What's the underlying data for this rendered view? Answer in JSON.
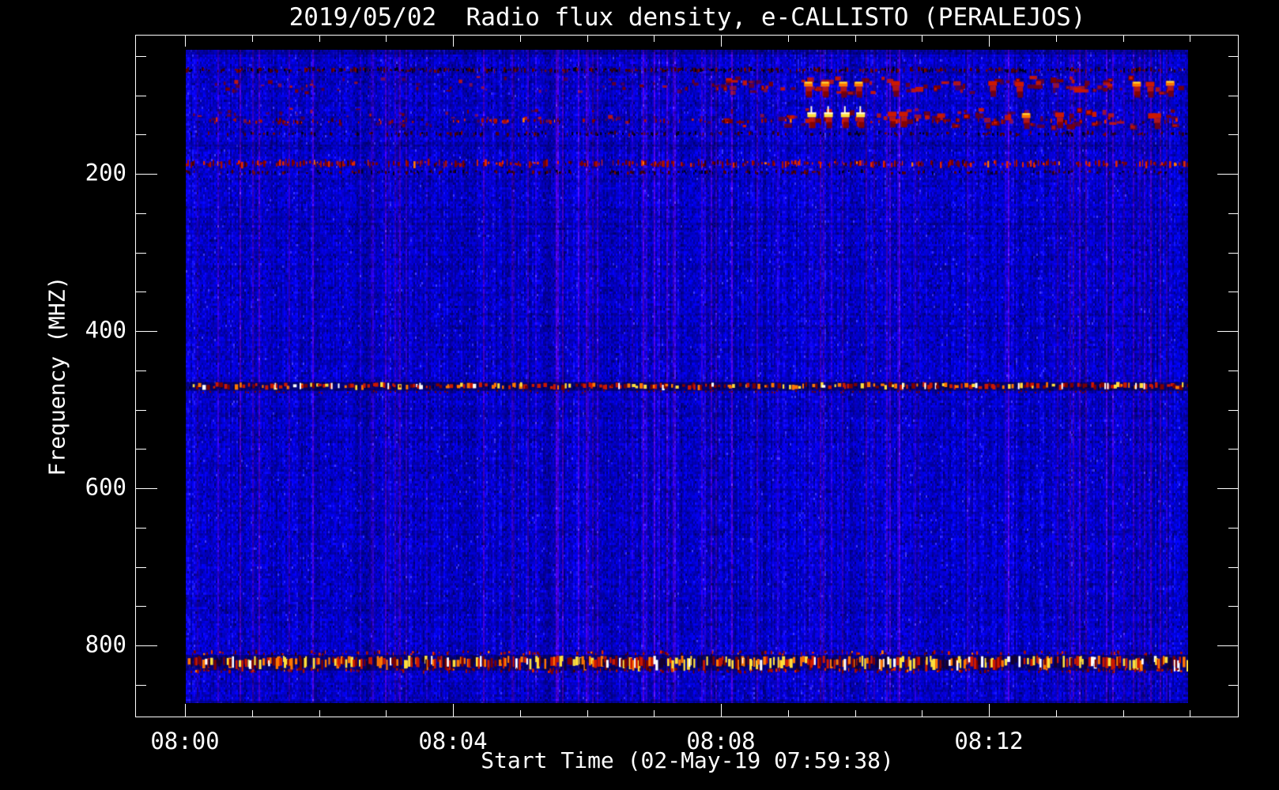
{
  "chart_data": {
    "type": "heatmap",
    "title": "2019/05/02  Radio flux density, e-CALLISTO (PERALEJOS)",
    "xlabel": "Start Time (02-May-19 07:59:38)",
    "ylabel": "Frequency (MHZ)",
    "instrument": "e-CALLISTO",
    "station": "PERALEJOS",
    "date": "2019/05/02",
    "start_time": "07:59:38",
    "x_axis": {
      "unit": "time (HH:MM)",
      "major_ticks": [
        {
          "label": "08:00",
          "minute": 0
        },
        {
          "label": "08:04",
          "minute": 4
        },
        {
          "label": "08:08",
          "minute": 8
        },
        {
          "label": "08:12",
          "minute": 12
        }
      ],
      "minor_tick_every_minutes": 1,
      "range_minutes": [
        0,
        15.03
      ]
    },
    "y_axis": {
      "unit": "MHz",
      "major_ticks": [
        {
          "label": "200",
          "value": 200
        },
        {
          "label": "400",
          "value": 400
        },
        {
          "label": "600",
          "value": 600
        },
        {
          "label": "800",
          "value": 800
        }
      ],
      "minor_tick_every_mhz": 50,
      "range_mhz": [
        42,
        873
      ],
      "increases_downward": true
    },
    "palette": {
      "page_background": "#000000",
      "frame": "#ffffff",
      "text": "#ffffff",
      "noise_base": "#1a11e0",
      "noise_dark": "#0d09b0",
      "noise_purple": "#4012cc",
      "noise_bright": "#2d26ff",
      "weak": "#7a0000",
      "medium": "#cc1800",
      "strong": "#ff7700",
      "very_strong": "#ffdf3c",
      "saturated": "#ffffff",
      "shadow": "#000050"
    },
    "bands": [
      {
        "f": 68,
        "type": "dark_speckles",
        "density": 0.55,
        "h": 4,
        "note": "dark interference row"
      },
      {
        "f": 85,
        "type": "blobs",
        "spread": 10,
        "note": "scattered red RFI blobs, stronger after 08:08"
      },
      {
        "f": 127,
        "type": "blobs",
        "spread": 11,
        "note": "scattered red RFI blobs with bright centres after 08:08"
      },
      {
        "f": 133,
        "type": "red_speckles",
        "density": 0.2,
        "h": 4
      },
      {
        "f": 149,
        "type": "dark_speckles",
        "density": 0.32,
        "h": 3
      },
      {
        "f": 163,
        "type": "dark_line",
        "alpha": 0.22
      },
      {
        "f": 187,
        "type": "red_speckles",
        "density": 0.5,
        "h": 7,
        "note": "strong speckled RFI band"
      },
      {
        "f": 198,
        "type": "dark_speckles",
        "density": 0.35,
        "h": 3
      },
      {
        "f": 244,
        "type": "dark_line",
        "alpha": 0.18
      },
      {
        "f": 263,
        "type": "dark_line",
        "alpha": 0.24
      },
      {
        "f": 270,
        "type": "dark_line",
        "alpha": 0.16
      },
      {
        "f": 379,
        "type": "dark_line",
        "alpha": 0.2,
        "t0": 4.3
      },
      {
        "f": 394,
        "type": "dark_line",
        "alpha": 0.22,
        "t0": 3.6
      },
      {
        "f": 470,
        "type": "bright_dashes",
        "note": "dense bright RFI line ~470 MHz"
      },
      {
        "f": 533,
        "type": "dark_line",
        "alpha": 0.13
      },
      {
        "f": 540,
        "type": "dark_line",
        "alpha": 0.1
      },
      {
        "f": 736,
        "type": "dark_line",
        "alpha": 0.1
      },
      {
        "f": 810,
        "type": "red_speckles",
        "density": 0.22,
        "h": 3
      },
      {
        "f": 821,
        "type": "rfi_band",
        "note": "very strong broadband RFI band ~820 MHz"
      },
      {
        "f": 832,
        "type": "red_speckles",
        "density": 0.28,
        "h": 3
      }
    ],
    "hot_spots": [
      {
        "t": 9.35,
        "f": 125,
        "level": "very_strong"
      },
      {
        "t": 9.6,
        "f": 125,
        "level": "very_strong"
      },
      {
        "t": 9.85,
        "f": 125,
        "level": "very_strong"
      },
      {
        "t": 10.08,
        "f": 125,
        "level": "very_strong"
      },
      {
        "t": 9.3,
        "f": 86,
        "level": "strong"
      },
      {
        "t": 9.55,
        "f": 86,
        "level": "strong"
      },
      {
        "t": 9.82,
        "f": 86,
        "level": "strong"
      },
      {
        "t": 10.05,
        "f": 86,
        "level": "strong"
      },
      {
        "t": 10.55,
        "f": 124,
        "level": "medium"
      },
      {
        "t": 10.72,
        "f": 124,
        "level": "medium"
      },
      {
        "t": 10.6,
        "f": 85,
        "level": "medium"
      },
      {
        "t": 12.05,
        "f": 85,
        "level": "medium"
      },
      {
        "t": 12.45,
        "f": 86,
        "level": "medium"
      },
      {
        "t": 12.55,
        "f": 126,
        "level": "strong"
      },
      {
        "t": 13.05,
        "f": 125,
        "level": "medium"
      },
      {
        "t": 14.2,
        "f": 86,
        "level": "strong"
      },
      {
        "t": 14.4,
        "f": 86,
        "level": "medium"
      },
      {
        "t": 14.7,
        "f": 85,
        "level": "strong"
      },
      {
        "t": 14.5,
        "f": 126,
        "level": "medium"
      }
    ]
  }
}
